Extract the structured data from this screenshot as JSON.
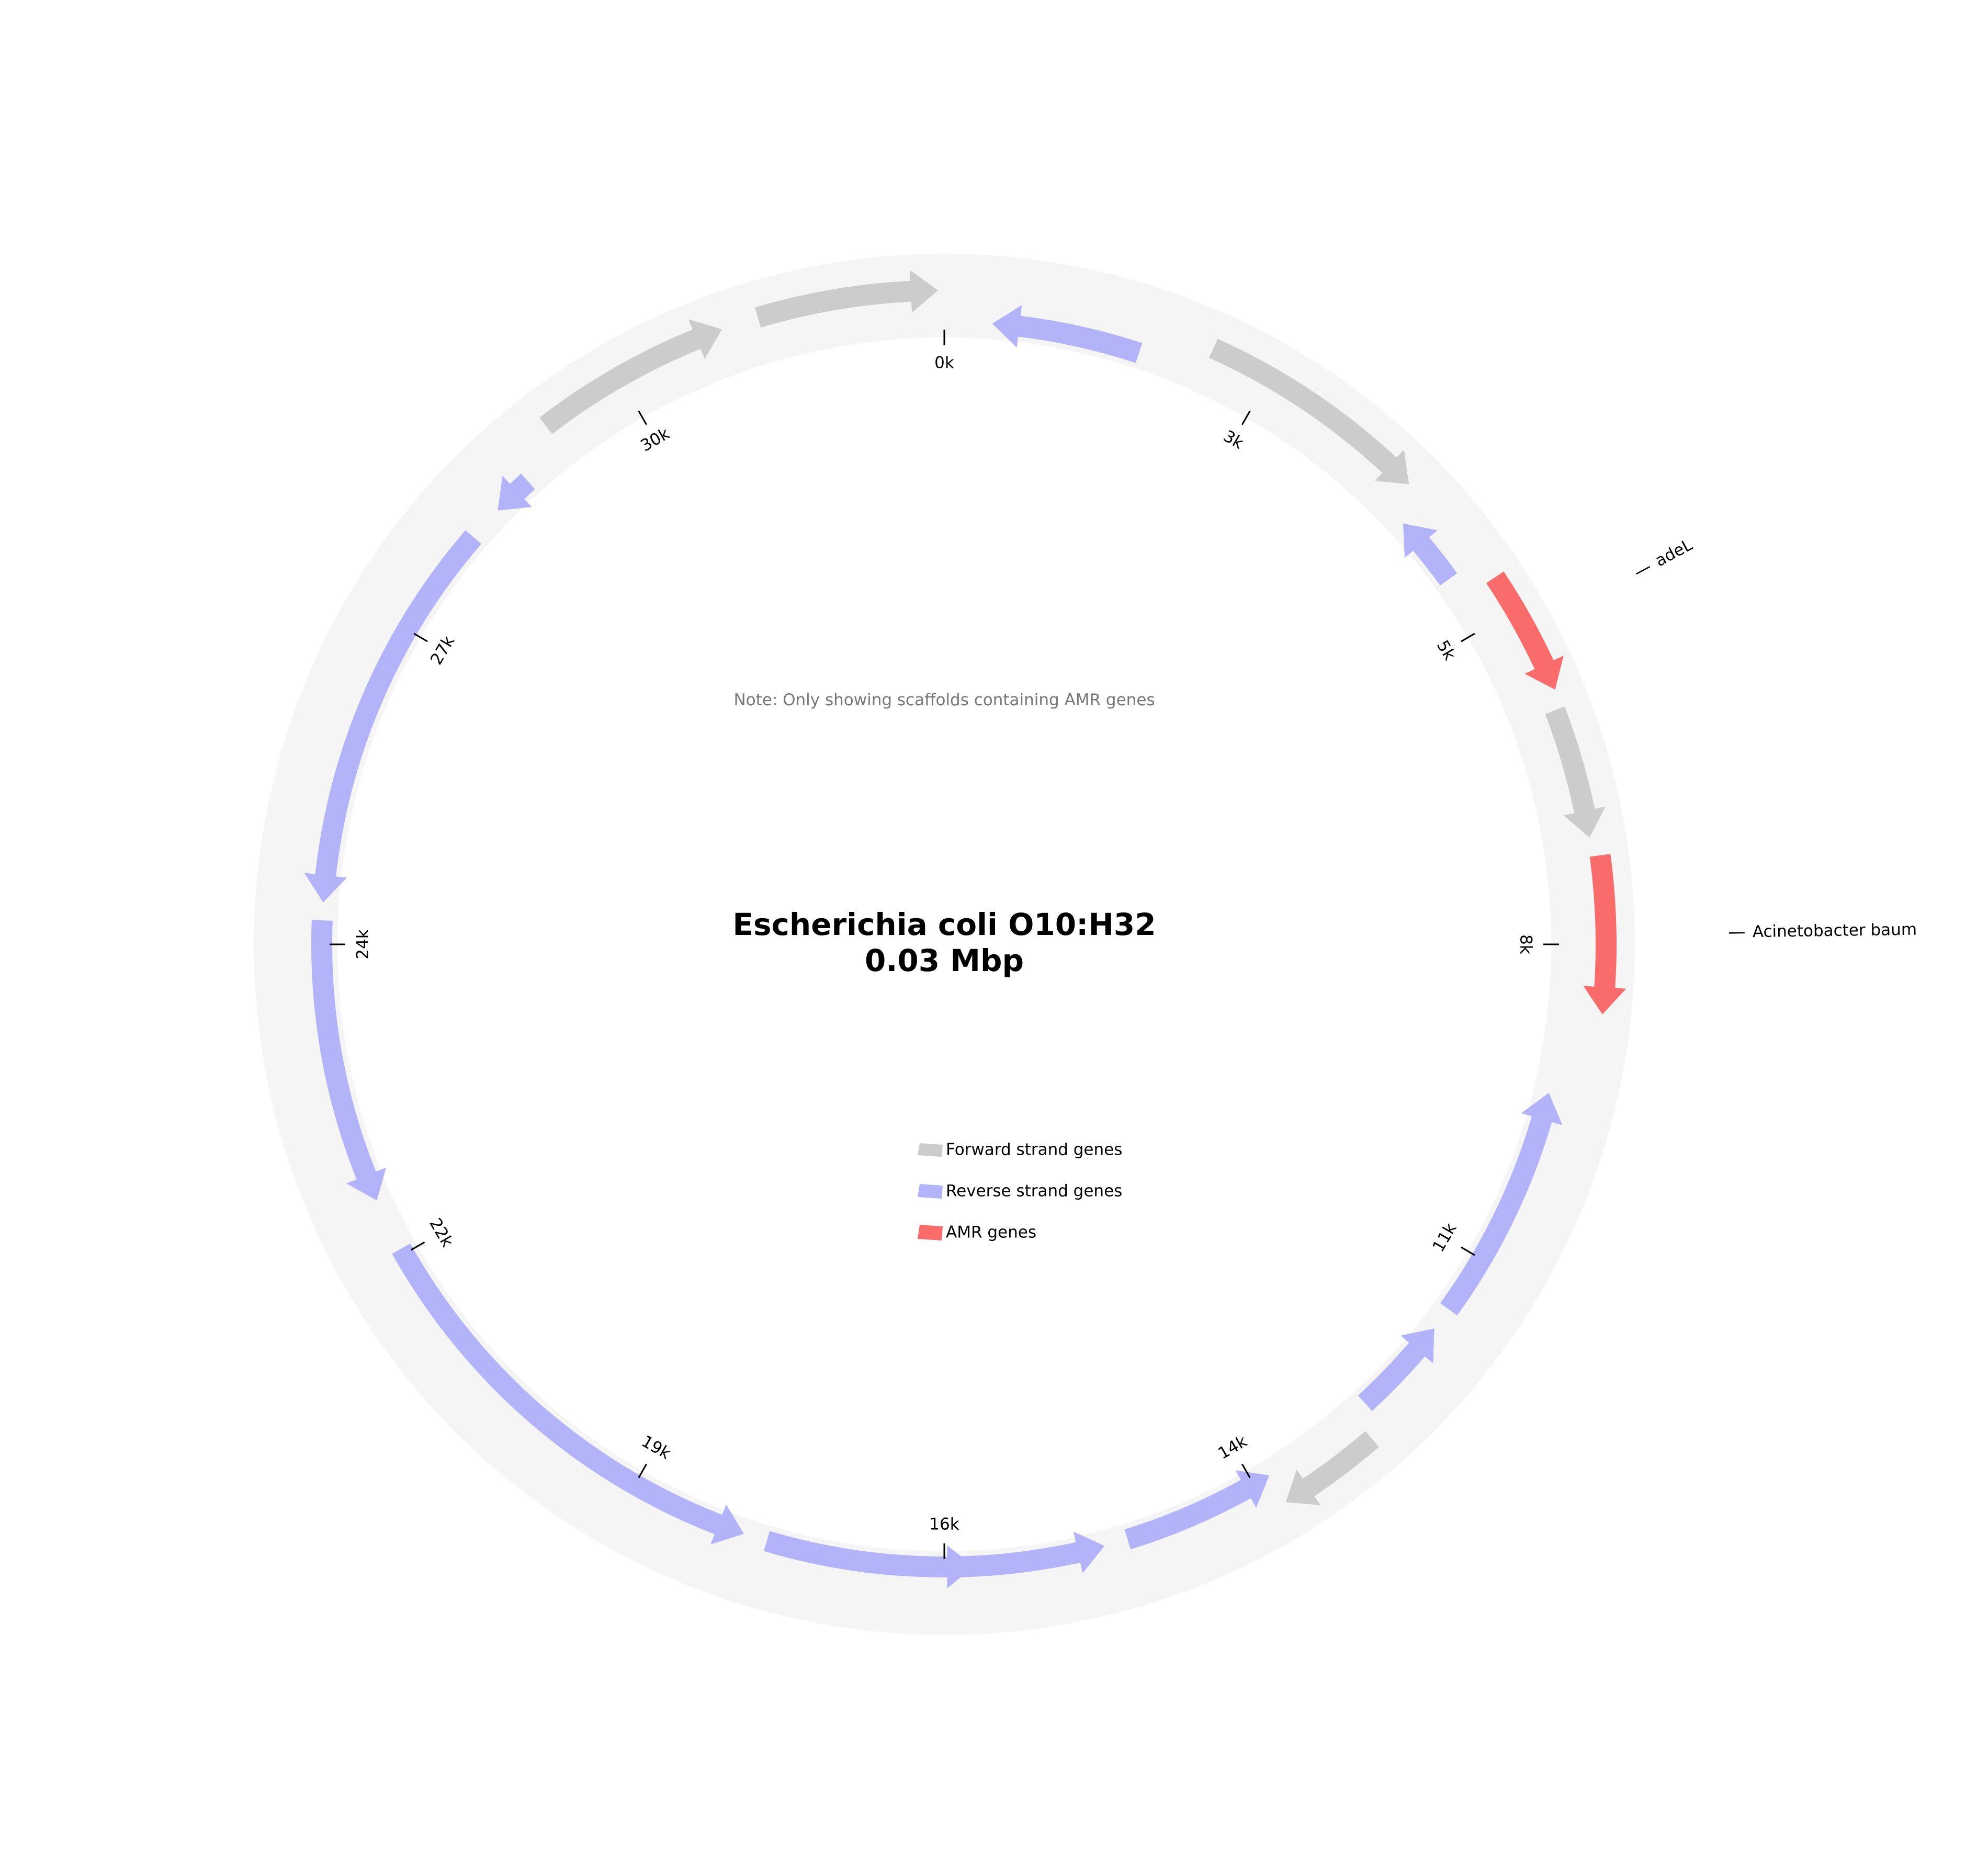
{
  "title": {
    "organism": "Escherichia coli O10:H32",
    "size": "0.03 Mbp"
  },
  "note": "Note: Only showing scaffolds containing AMR genes",
  "colors": {
    "forward": "#cccccc",
    "reverse": "#b3b3fa",
    "amr": "#fa6b6b",
    "backbone": "#f5f5f5",
    "tick": "#000000",
    "note": "#777777"
  },
  "legend": [
    {
      "key": "forward",
      "label": "Forward strand genes"
    },
    {
      "key": "reverse",
      "label": "Reverse strand genes"
    },
    {
      "key": "amr",
      "label": "AMR genes"
    }
  ],
  "genome": {
    "length_bp": 32600,
    "ticks": [
      {
        "pos": 0,
        "label": "0k"
      },
      {
        "pos": 2700,
        "label": "3k"
      },
      {
        "pos": 5400,
        "label": "5k"
      },
      {
        "pos": 8150,
        "label": "8k"
      },
      {
        "pos": 10900,
        "label": "11k"
      },
      {
        "pos": 13600,
        "label": "14k"
      },
      {
        "pos": 16300,
        "label": "16k"
      },
      {
        "pos": 19000,
        "label": "19k"
      },
      {
        "pos": 21750,
        "label": "22k"
      },
      {
        "pos": 24450,
        "label": "24k"
      },
      {
        "pos": 27200,
        "label": "27k"
      },
      {
        "pos": 29900,
        "label": "30k"
      }
    ],
    "genes": [
      {
        "start": 31100,
        "end": 32550,
        "type": "forward"
      },
      {
        "start": 29200,
        "end": 30800,
        "type": "forward"
      },
      {
        "start": 28450,
        "end": 28800,
        "type": "reverse"
      },
      {
        "start": 24800,
        "end": 28150,
        "type": "reverse"
      },
      {
        "start": 22250,
        "end": 24650,
        "type": "reverse"
      },
      {
        "start": 18000,
        "end": 21800,
        "type": "reverse"
      },
      {
        "start": 16050,
        "end": 17800,
        "type": "reverse"
      },
      {
        "start": 14950,
        "end": 16200,
        "type": "reverse"
      },
      {
        "start": 13450,
        "end": 14750,
        "type": "reverse"
      },
      {
        "start": 12600,
        "end": 13450,
        "type": "forward"
      },
      {
        "start": 11600,
        "end": 12450,
        "type": "reverse"
      },
      {
        "start": 9400,
        "end": 11400,
        "type": "reverse"
      },
      {
        "start": 7450,
        "end": 8700,
        "type": "amr",
        "label": "Acinetobacter baum"
      },
      {
        "start": 6250,
        "end": 7300,
        "type": "forward"
      },
      {
        "start": 5100,
        "end": 6100,
        "type": "amr",
        "label": "adeL"
      },
      {
        "start": 4300,
        "end": 4900,
        "type": "reverse"
      },
      {
        "start": 2200,
        "end": 4100,
        "type": "forward"
      },
      {
        "start": 400,
        "end": 1650,
        "type": "reverse"
      }
    ]
  }
}
